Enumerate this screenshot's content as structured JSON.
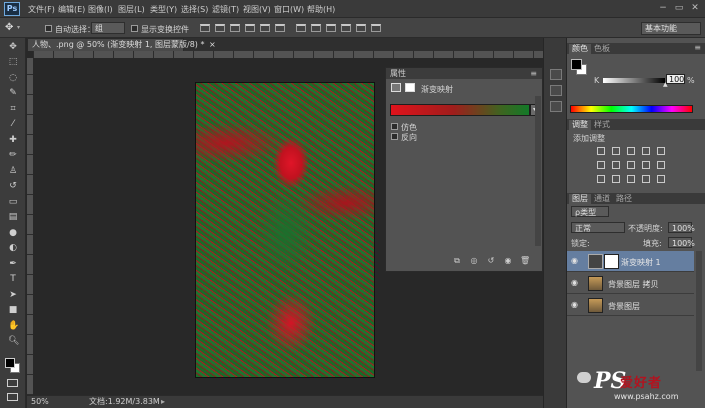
{
  "app": {
    "logo": "Ps"
  },
  "menu": [
    "文件(F)",
    "编辑(E)",
    "图像(I)",
    "图层(L)",
    "类型(Y)",
    "选择(S)",
    "滤镜(T)",
    "视图(V)",
    "窗口(W)",
    "帮助(H)"
  ],
  "window_controls": [
    "−",
    "▭",
    "✕"
  ],
  "options_bar": {
    "auto_select_label": "自动选择：",
    "auto_select_value": "组",
    "show_transform_label": "显示变换控件",
    "workspace": "基本功能"
  },
  "document_tab": {
    "title": "人物、.png @ 50% (渐变映射 1, 图层蒙版/8) *",
    "close": "×"
  },
  "status_bar": {
    "zoom": "50%",
    "doc_size": "文档:1.92M/3.83M"
  },
  "properties_panel": {
    "title": "属性",
    "adjustment_name": "渐变映射",
    "options": [
      "仿色",
      "反向"
    ],
    "gradient_colors": [
      "#e1131c",
      "#137a28"
    ]
  },
  "color_panel": {
    "tabs": [
      "颜色",
      "色板"
    ],
    "channel_label": "K",
    "value": "100",
    "unit": "%",
    "foreground": "#000000",
    "background": "#ffffff"
  },
  "adjustments_panel": {
    "tabs": [
      "调整",
      "样式"
    ],
    "add_label": "添加调整"
  },
  "layers_panel": {
    "tabs": [
      "图层",
      "通道",
      "路径"
    ],
    "filter_kind": "ρ类型",
    "blend_mode": "正常",
    "opacity_label": "不透明度:",
    "opacity_value": "100%",
    "lock_label": "锁定:",
    "fill_label": "填充:",
    "fill_value": "100%",
    "layers": [
      {
        "name": "渐变映射 1",
        "selected": true
      },
      {
        "name": "背景图层 拷贝",
        "selected": false
      },
      {
        "name": "背景图层",
        "selected": false
      }
    ]
  },
  "watermark": {
    "logo": "PS",
    "text": "爱好者",
    "url": "www.psahz.com"
  }
}
